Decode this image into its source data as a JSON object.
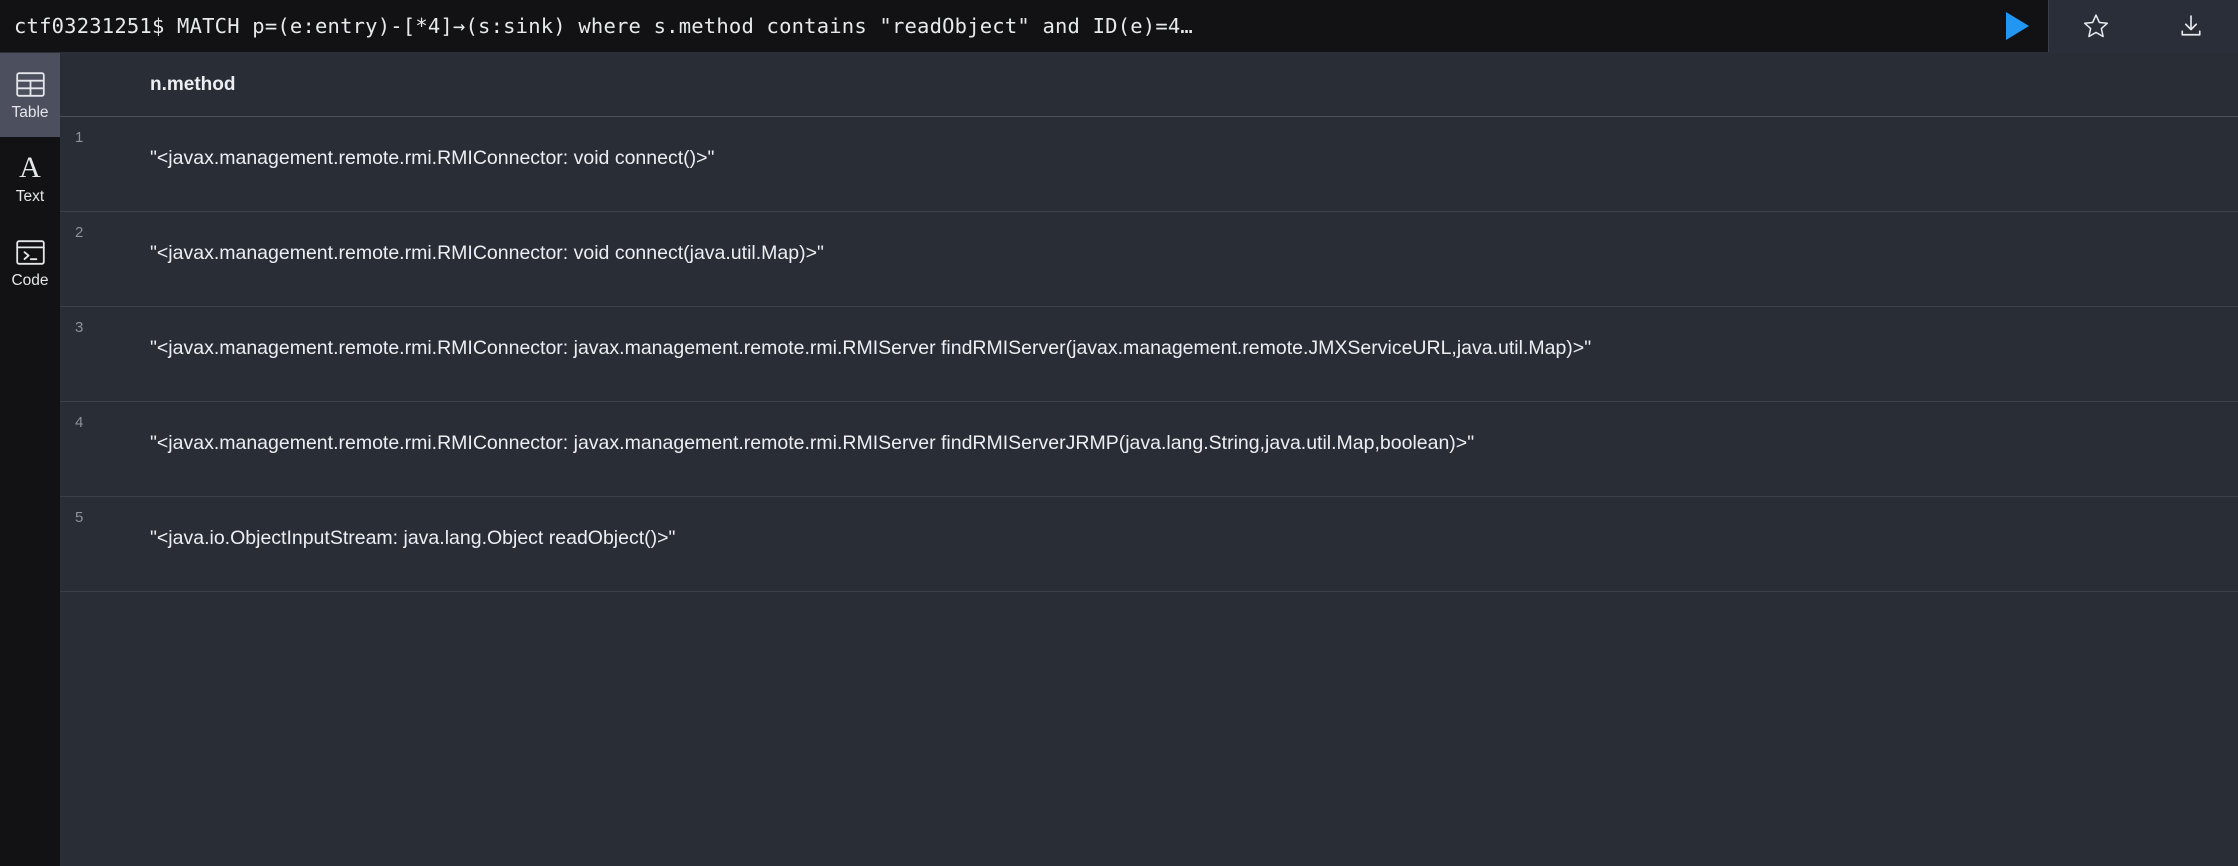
{
  "query_bar": {
    "prompt": "ctf03231251$",
    "query": "MATCH p=(e:entry)-[*4]→(s:sink) where s.method contains \"readObject\" and ID(e)=4…",
    "full_text": "ctf03231251$ MATCH p=(e:entry)-[*4]→(s:sink) where s.method contains \"readObject\" and ID(e)=4…",
    "run_label": "run-query",
    "favorite_label": "favorite",
    "download_label": "download",
    "accent_color": "#2196f3",
    "background": "#121214",
    "actions_background": "#2a2e38"
  },
  "sidebar": {
    "items": [
      {
        "id": "table",
        "label": "Table",
        "icon": "table-icon",
        "active": true
      },
      {
        "id": "text",
        "label": "Text",
        "icon": "text-a-icon",
        "active": false
      },
      {
        "id": "code",
        "label": "Code",
        "icon": "code-terminal-icon",
        "active": false
      }
    ],
    "active_background": "#4c4f5e",
    "background": "#121214"
  },
  "results": {
    "background": "#292d36",
    "columns": [
      "n.method"
    ],
    "rows": [
      {
        "number": "1",
        "n.method": "\"<javax.management.remote.rmi.RMIConnector: void connect()>\""
      },
      {
        "number": "2",
        "n.method": "\"<javax.management.remote.rmi.RMIConnector: void connect(java.util.Map)>\""
      },
      {
        "number": "3",
        "n.method": "\"<javax.management.remote.rmi.RMIConnector: javax.management.remote.rmi.RMIServer findRMIServer(javax.management.remote.JMXServiceURL,java.util.Map)>\""
      },
      {
        "number": "4",
        "n.method": "\"<javax.management.remote.rmi.RMIConnector: javax.management.remote.rmi.RMIServer findRMIServerJRMP(java.lang.String,java.util.Map,boolean)>\""
      },
      {
        "number": "5",
        "n.method": "\"<java.io.ObjectInputStream: java.lang.Object readObject()>\""
      }
    ]
  }
}
